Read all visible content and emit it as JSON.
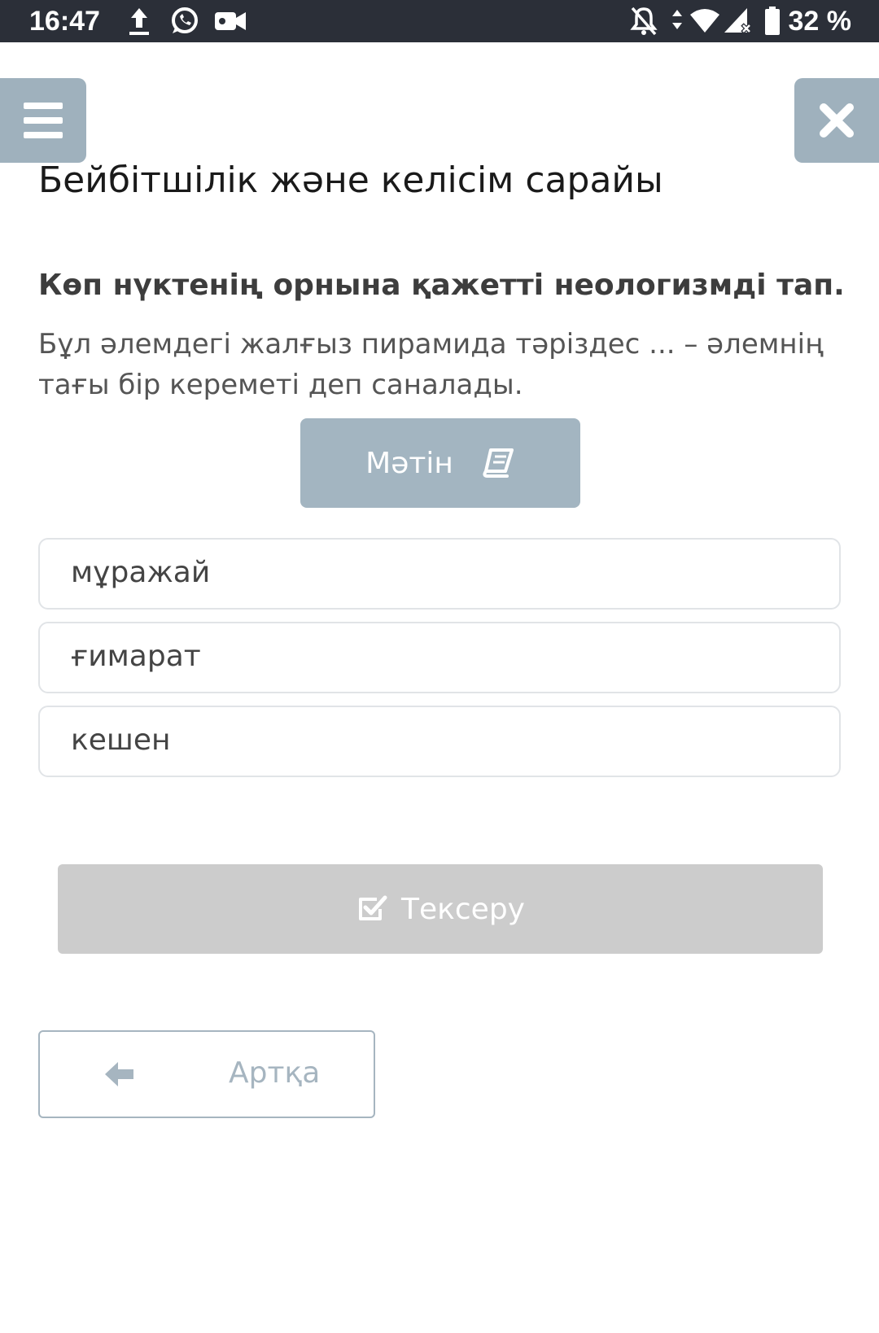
{
  "status_bar": {
    "time": "16:47",
    "battery": "32 %",
    "icons": [
      "upload-icon",
      "whatsapp-icon",
      "video-camera-icon",
      "bell-off-icon",
      "data-arrows-icon",
      "wifi-icon",
      "signal-icon",
      "battery-icon"
    ]
  },
  "header": {
    "menu_icon": "hamburger-menu-icon",
    "close_icon": "close-icon",
    "title": "Бейбітшілік және келісім сарайы"
  },
  "task": {
    "instruction": "Көп нүктенің орнына қажетті неологизмді тап.",
    "question": "Бұл әлемдегі жалғыз пирамида тәріздес ... – әлемнің тағы бір кереметі деп саналады.",
    "text_button_label": "Мәтін",
    "text_button_icon": "book-icon"
  },
  "options": [
    {
      "label": "мұражай"
    },
    {
      "label": "ғимарат"
    },
    {
      "label": "кешен"
    }
  ],
  "actions": {
    "check_label": "Тексеру",
    "check_icon": "checkbox-icon",
    "back_label": "Артқа",
    "back_icon": "arrow-left-icon"
  },
  "colors": {
    "status_bar_bg": "#2b2f38",
    "accent_button": "#9fb1bd",
    "disabled_button": "#cccccc",
    "option_border": "#e1e4e7"
  }
}
